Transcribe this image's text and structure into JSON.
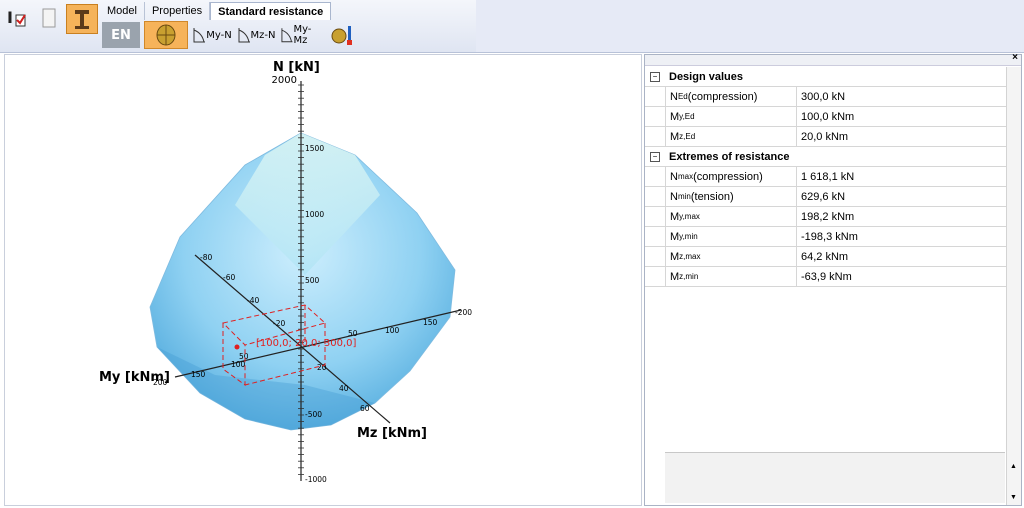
{
  "toolbar": {
    "tabs": [
      "Model",
      "Properties",
      "Standard resistance"
    ],
    "active_tab": "Standard resistance",
    "lang": "EN",
    "ribbon_buttons": [
      "My-N",
      "Mz-N",
      "My-Mz"
    ]
  },
  "plot": {
    "axis_n": "N [kN]",
    "axis_my": "My [kNm]",
    "axis_mz": "Mz [kNm]",
    "n_ticks": [
      "2000",
      "1500",
      "1000",
      "500",
      "-500",
      "-1000"
    ],
    "my_ticks": [
      "-80",
      "-60",
      "-40",
      "-20",
      "50",
      "100",
      "150",
      "200"
    ],
    "mz_ticks": [
      "50",
      "100",
      "150",
      "-200",
      "20",
      "40",
      "60"
    ],
    "point_label": "[100,0; 20,0; 300,0]",
    "colors": {
      "surface": "#8fd1f2",
      "point": "#e02020"
    }
  },
  "panel": {
    "design_values": {
      "title": "Design values",
      "rows": [
        {
          "sym": "N",
          "sub": "Ed",
          "tail": " (compression)",
          "value": "300,0 kN"
        },
        {
          "sym": "M",
          "sub": "y,Ed",
          "tail": "",
          "value": "100,0 kNm"
        },
        {
          "sym": "M",
          "sub": "z,Ed",
          "tail": "",
          "value": "20,0 kNm"
        }
      ]
    },
    "extremes": {
      "title": "Extremes of resistance",
      "rows": [
        {
          "sym": "N",
          "sub": "max",
          "tail": " (compression)",
          "value": "1 618,1 kN"
        },
        {
          "sym": "N",
          "sub": "min",
          "tail": " (tension)",
          "value": "629,6 kN"
        },
        {
          "sym": "M",
          "sub": "y,max",
          "tail": "",
          "value": "198,2 kNm"
        },
        {
          "sym": "M",
          "sub": "y,min",
          "tail": "",
          "value": "-198,3 kNm"
        },
        {
          "sym": "M",
          "sub": "z,max",
          "tail": "",
          "value": "64,2 kNm"
        },
        {
          "sym": "M",
          "sub": "z,min",
          "tail": "",
          "value": "-63,9 kNm"
        }
      ]
    }
  }
}
